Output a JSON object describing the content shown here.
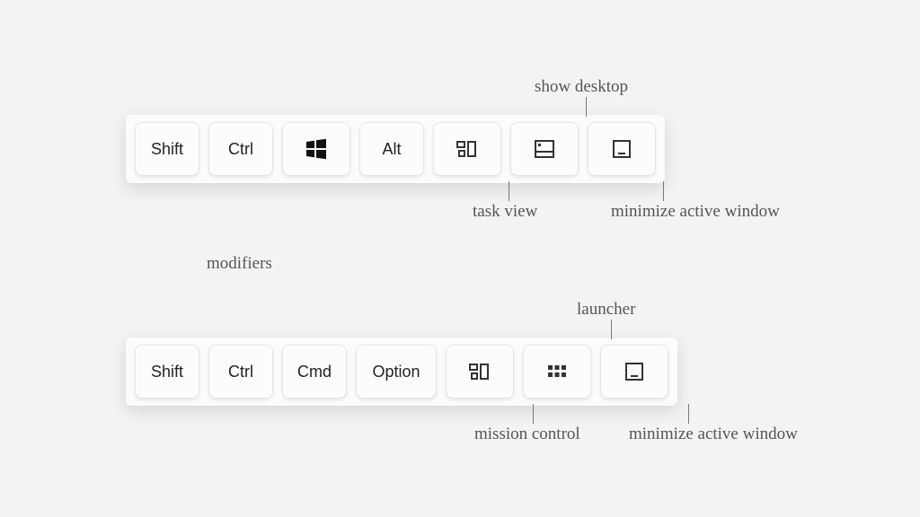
{
  "section_label": "modifiers",
  "row1": {
    "keys": {
      "shift": "Shift",
      "ctrl": "Ctrl",
      "alt": "Alt"
    },
    "annotations": {
      "task_view": "task view",
      "show_desktop": "show desktop",
      "minimize": "minimize active window"
    }
  },
  "row2": {
    "keys": {
      "shift": "Shift",
      "ctrl": "Ctrl",
      "cmd": "Cmd",
      "option": "Option"
    },
    "annotations": {
      "mission_control": "mission control",
      "launcher": "launcher",
      "minimize": "minimize active window"
    }
  }
}
